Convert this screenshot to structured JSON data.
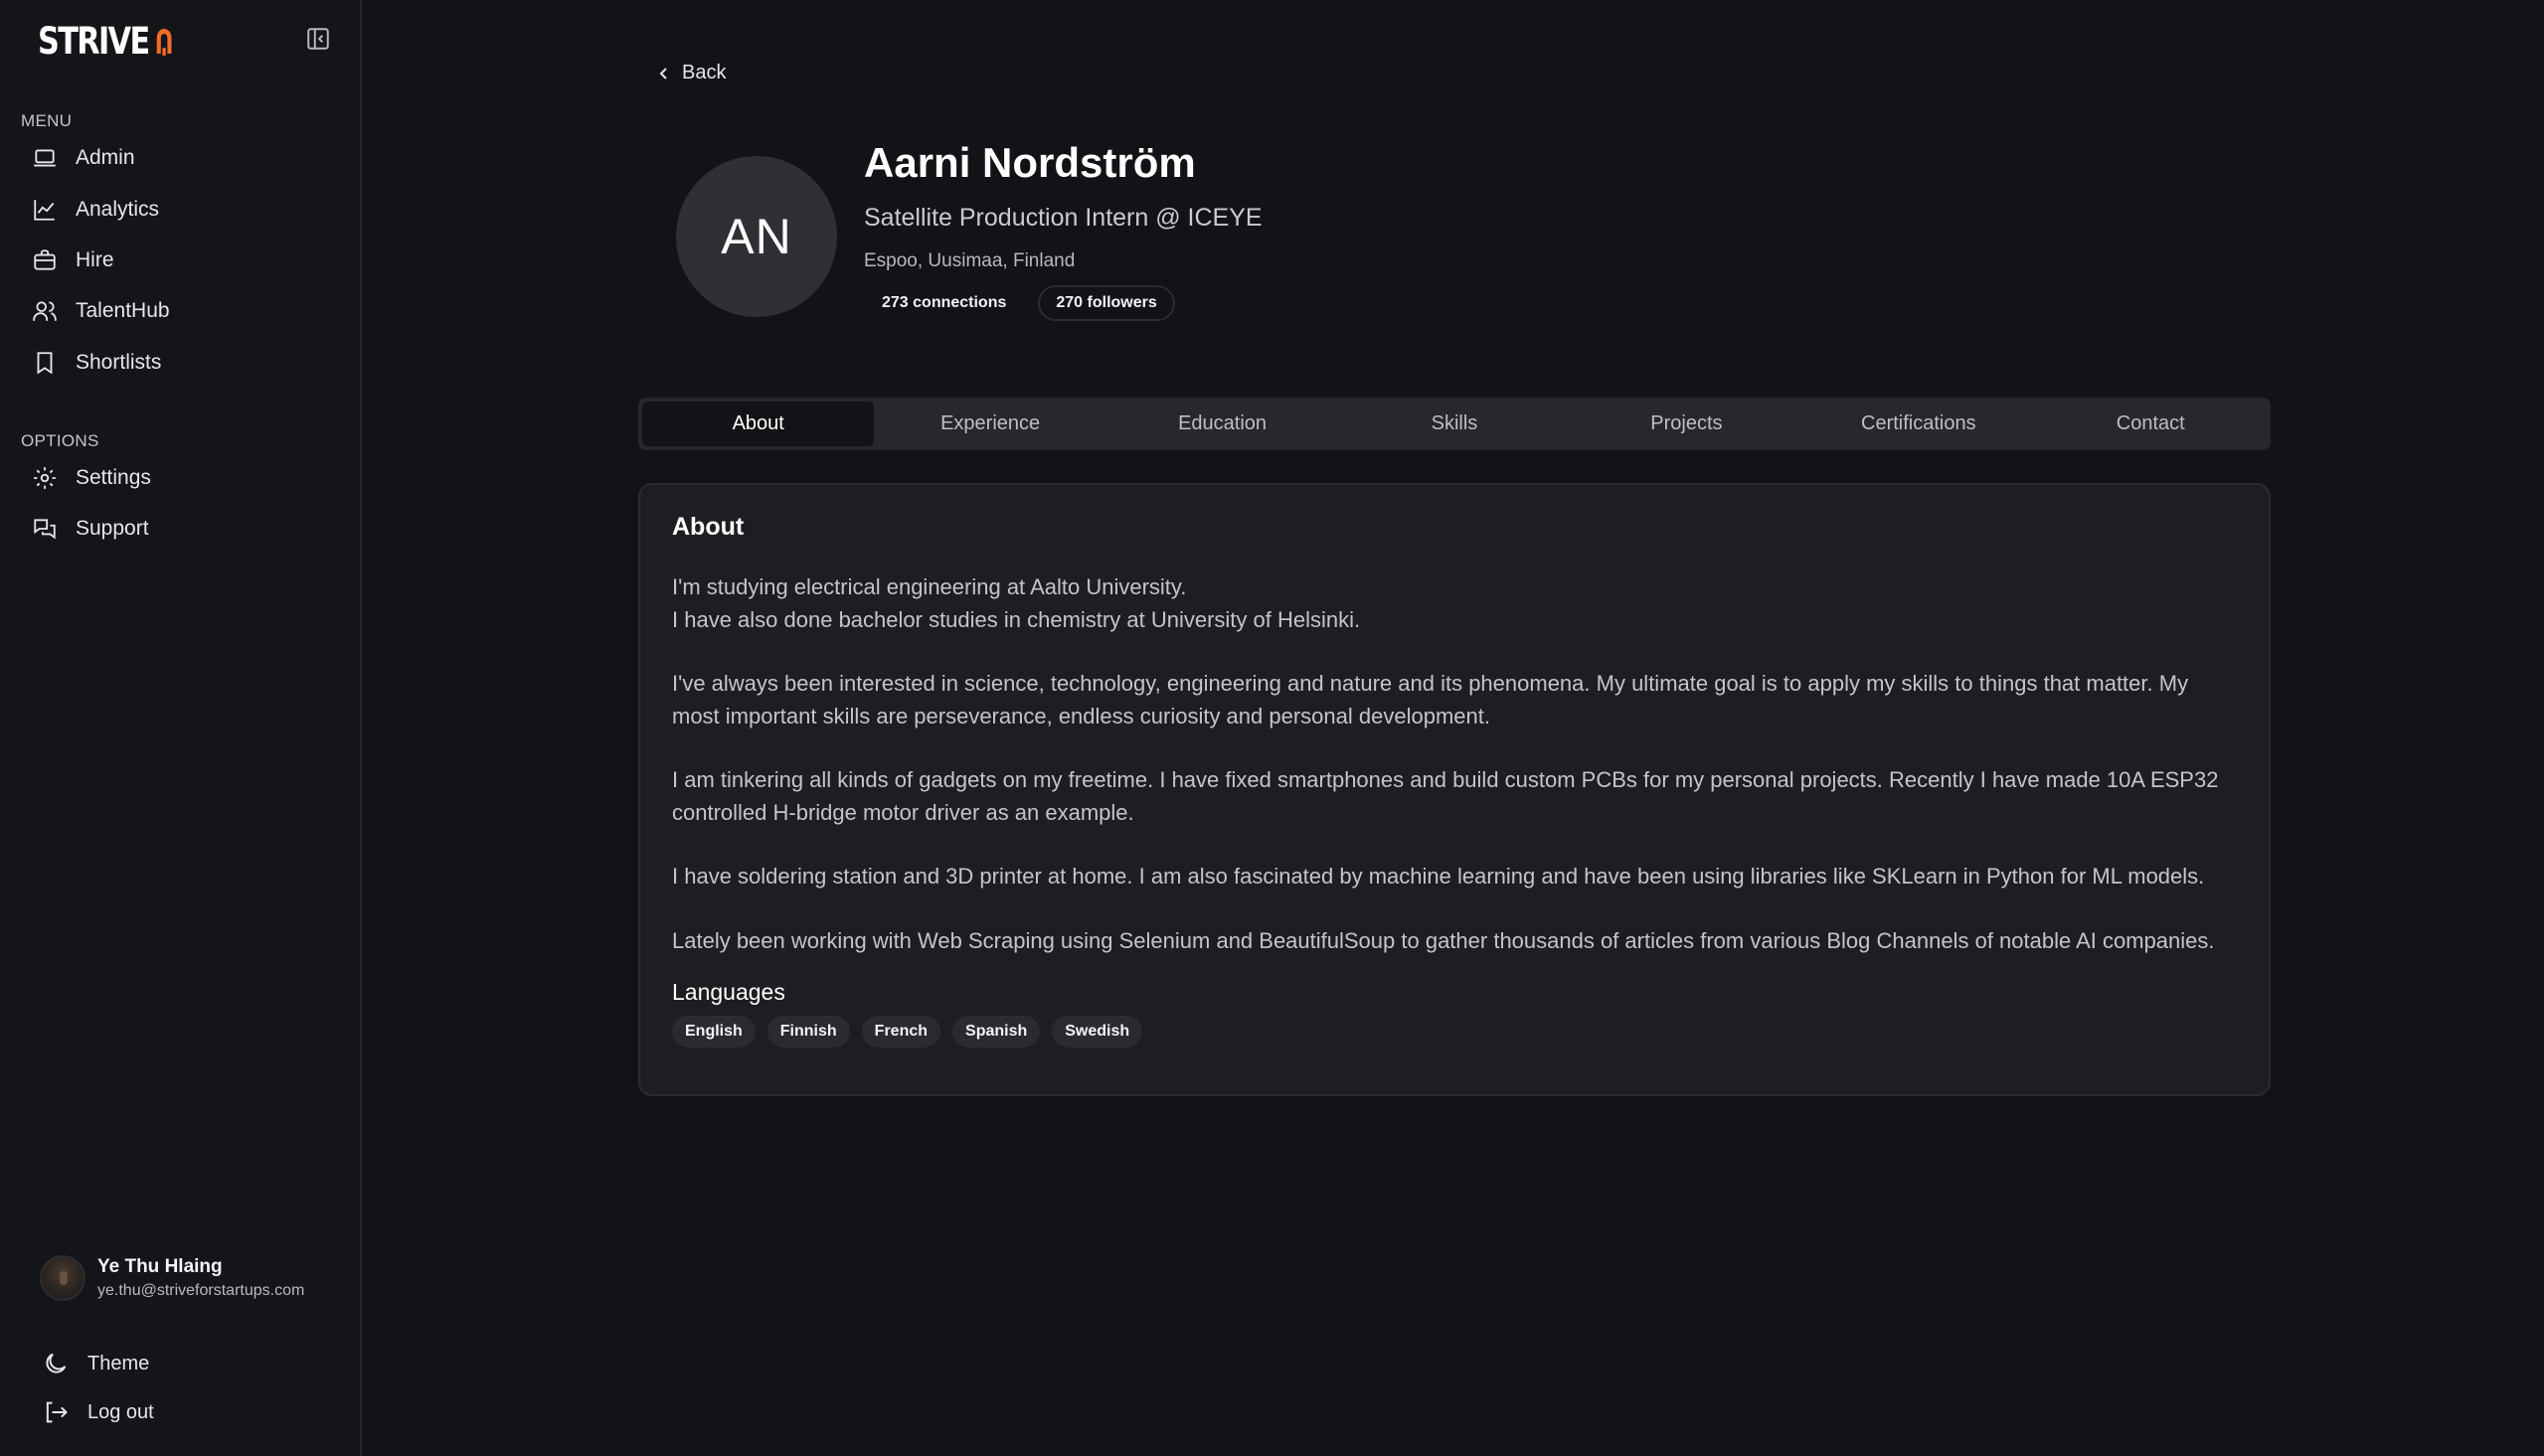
{
  "brand": {
    "name": "STRIVE",
    "accent": "#f26b2a"
  },
  "sidebar": {
    "menu_label": "MENU",
    "menu_items": [
      {
        "label": "Admin",
        "icon": "laptop-icon"
      },
      {
        "label": "Analytics",
        "icon": "chart-line-icon"
      },
      {
        "label": "Hire",
        "icon": "briefcase-icon"
      },
      {
        "label": "TalentHub",
        "icon": "users-icon"
      },
      {
        "label": "Shortlists",
        "icon": "bookmark-icon"
      }
    ],
    "options_label": "OPTIONS",
    "option_items": [
      {
        "label": "Settings",
        "icon": "gear-icon"
      },
      {
        "label": "Support",
        "icon": "chat-icon"
      }
    ],
    "user": {
      "name": "Ye Thu Hlaing",
      "email": "ye.thu@striveforstartups.com"
    },
    "theme_label": "Theme",
    "logout_label": "Log out"
  },
  "main": {
    "back_label": "Back",
    "profile": {
      "initials": "AN",
      "name": "Aarni Nordström",
      "headline": "Satellite Production Intern @ ICEYE",
      "location": "Espoo, Uusimaa, Finland",
      "connections": "273 connections",
      "followers": "270 followers"
    },
    "tabs": [
      "About",
      "Experience",
      "Education",
      "Skills",
      "Projects",
      "Certifications",
      "Contact"
    ],
    "active_tab": "About",
    "about": {
      "title": "About",
      "paragraphs": [
        "I'm studying electrical engineering at Aalto University.\nI have also done bachelor studies in chemistry at University of Helsinki.",
        "I've always been interested in science, technology, engineering and nature and its phenomena. My ultimate goal is to apply my skills to things that matter. My most important skills are perseverance, endless curiosity and personal development.",
        "I am tinkering all kinds of gadgets on my freetime. I have fixed smartphones and build custom PCBs for my personal projects. Recently I have made 10A ESP32 controlled H-bridge motor driver as an example.",
        "I have soldering station and 3D printer at home. I am also fascinated by machine learning and have been using libraries like SKLearn in Python for ML models.",
        "Lately been working with Web Scraping using Selenium and BeautifulSoup to gather thousands of articles from various Blog Channels of notable AI companies."
      ],
      "languages_title": "Languages",
      "languages": [
        "English",
        "Finnish",
        "French",
        "Spanish",
        "Swedish"
      ]
    }
  }
}
